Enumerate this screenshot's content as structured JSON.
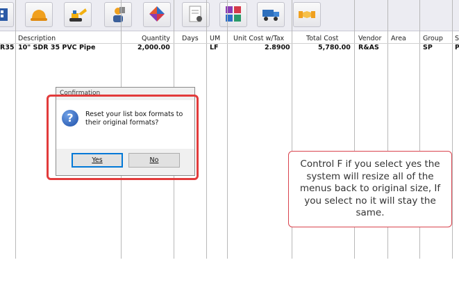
{
  "toolbar": {
    "icons": [
      "hardhat-icon",
      "excavator-icon",
      "worker-icon",
      "diamond-shapes-icon",
      "contract-document-icon",
      "color-blocks-icon",
      "dump-truck-icon",
      "handshake-icon"
    ]
  },
  "table": {
    "partial_left_cell": "R35",
    "headers": [
      "Description",
      "Quantity",
      "Days",
      "UM",
      "Unit Cost w/Tax",
      "Total Cost",
      "Vendor",
      "Area",
      "Group",
      "S"
    ],
    "row": {
      "description": "10\" SDR 35 PVC Pipe",
      "quantity": "2,000.00",
      "days": "",
      "um": "LF",
      "unit_cost": "2.8900",
      "total_cost": "5,780.00",
      "vendor": "R&AS",
      "area": "",
      "group": "SP",
      "s": "P"
    }
  },
  "dialog": {
    "title": "Confirmation",
    "message": "Reset your list box formats to their original formats?",
    "yes_label": "Yes",
    "no_label": "No"
  },
  "callout": {
    "text": "Control F if you select yes the system will resize all of the menus back to original size, If you select no it will stay the same."
  },
  "colors": {
    "highlight": "#e23b3b",
    "callout_border": "#d9434d",
    "question_icon": "#1d4fa8"
  }
}
